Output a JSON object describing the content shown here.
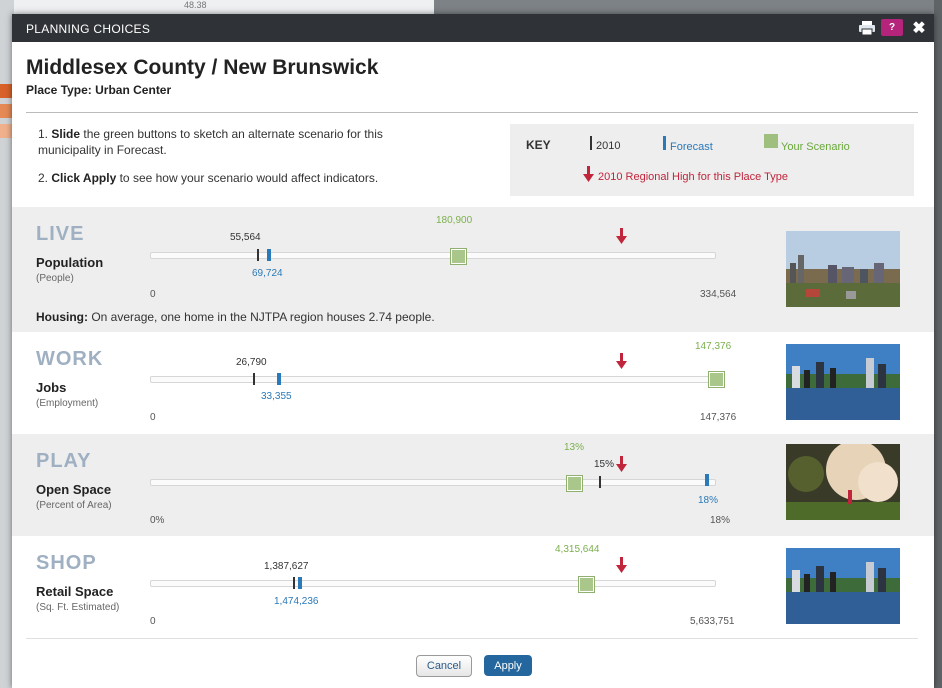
{
  "background": {
    "top_value": "48.38"
  },
  "titlebar": {
    "title": "PLANNING CHOICES",
    "help_label": "?",
    "close_label": "✖"
  },
  "header": {
    "title": "Middlesex County / New Brunswick",
    "subtitle": "Place Type: Urban Center"
  },
  "instructions": [
    {
      "number": "1.",
      "bold": "Slide",
      "text": " the green buttons to sketch an alternate scenario for this municipality in Forecast."
    },
    {
      "number": "2.",
      "bold": "Click Apply",
      "text": " to see how your scenario would affect indicators."
    }
  ],
  "key": {
    "label": "KEY",
    "year": "2010",
    "forecast": "Forecast",
    "scenario": "Your Scenario",
    "regional_high": "2010 Regional High for this Place Type"
  },
  "colors": {
    "forecast": "#2a79b8",
    "scenario": "#7bb04d",
    "regional_high": "#c0253c",
    "section_title": "#9fb0c2"
  },
  "sections": [
    {
      "title": "LIVE",
      "label": "Population",
      "unit": "(People)",
      "value_2010": "55,564",
      "forecast": "69,724",
      "scenario": "180,900",
      "axis_min": "0",
      "axis_max": "334,564",
      "photo": "city-skyline-photo"
    },
    {
      "title": "WORK",
      "label": "Jobs",
      "unit": "(Employment)",
      "value_2010": "26,790",
      "forecast": "33,355",
      "scenario": "147,376",
      "axis_min": "0",
      "axis_max": "147,376",
      "photo": "river-skyline-photo"
    },
    {
      "title": "PLAY",
      "label": "Open Space",
      "unit": "(Percent of Area)",
      "value_2010": "15%",
      "forecast": "18%",
      "scenario": "13%",
      "axis_min": "0%",
      "axis_max": "18%",
      "photo": "park-tree-photo"
    },
    {
      "title": "SHOP",
      "label": "Retail Space",
      "unit": "(Sq. Ft. Estimated)",
      "value_2010": "1,387,627",
      "forecast": "1,474,236",
      "scenario": "4,315,644",
      "axis_min": "0",
      "axis_max": "5,633,751",
      "photo": "river-skyline-photo"
    }
  ],
  "housing": {
    "bold": "Housing:",
    "text": " On average, one home in the NJTPA region houses 2.74 people."
  },
  "buttons": {
    "cancel": "Cancel",
    "apply": "Apply"
  }
}
